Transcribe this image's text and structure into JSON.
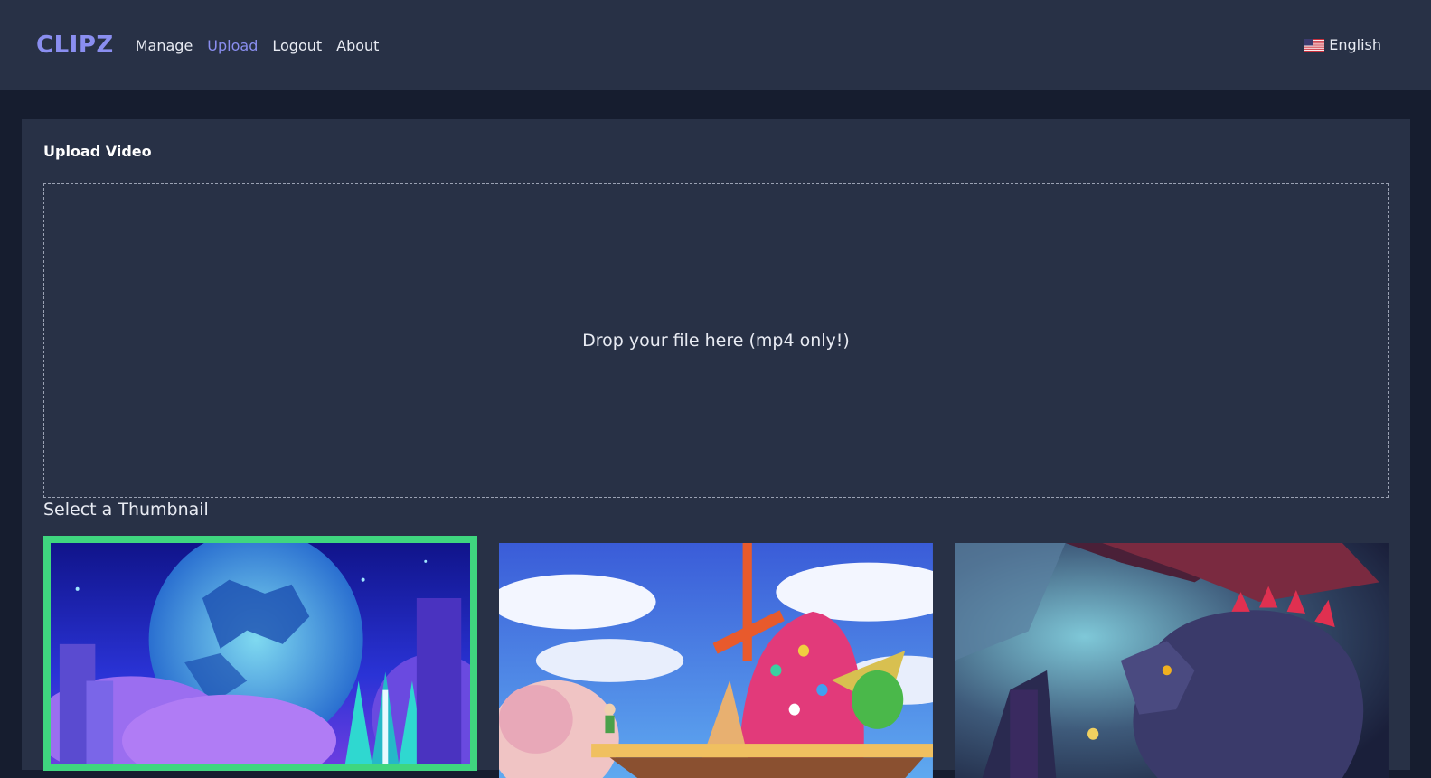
{
  "header": {
    "logo": "CLIPZ",
    "nav": [
      {
        "label": "Manage",
        "active": false
      },
      {
        "label": "Upload",
        "active": true
      },
      {
        "label": "Logout",
        "active": false
      },
      {
        "label": "About",
        "active": false
      }
    ],
    "language": {
      "label": "English",
      "icon": "us-flag-icon"
    }
  },
  "upload": {
    "title": "Upload Video",
    "dropzone_text": "Drop your file here (mp4 only!)",
    "thumbnail_heading": "Select a Thumbnail",
    "thumbnails": [
      {
        "name": "thumbnail-1",
        "selected": true,
        "scene": "moonlit-crystal-city"
      },
      {
        "name": "thumbnail-2",
        "selected": false,
        "scene": "sky-windmill-island"
      },
      {
        "name": "thumbnail-3",
        "selected": false,
        "scene": "dragon-cave"
      }
    ]
  },
  "colors": {
    "accent": "#8a8ef0",
    "selected_border": "#3fd67f",
    "header_bg": "#283146",
    "page_bg": "#161d2f"
  }
}
